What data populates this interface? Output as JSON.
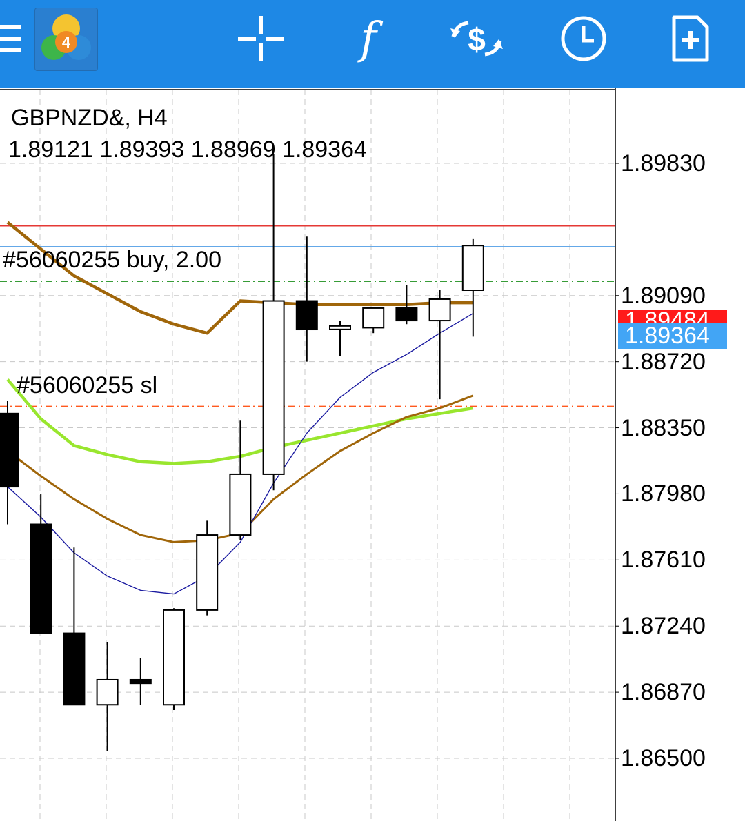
{
  "toolbar": {
    "background": "#1e88e5",
    "icons": [
      "menu-icon",
      "mt4-logo",
      "crosshair-icon",
      "indicators-icon",
      "trade-icon",
      "timeframe-clock-icon",
      "new-order-icon"
    ]
  },
  "chart": {
    "symbol_timeframe": "GBPNZD&, H4",
    "ohlc": "1.89121 1.89393 1.88969 1.89364",
    "order_label": "#56060255 buy, 2.00",
    "sl_label": "#56060255 sl",
    "current_price": "1.89364",
    "ask_price": "1.89484",
    "axis_ticks": [
      "1.89830",
      "1.89090",
      "1.88720",
      "1.88350",
      "1.87980",
      "1.87610",
      "1.87240",
      "1.86870",
      "1.86500"
    ]
  },
  "chart_data": {
    "type": "candlestick",
    "title": "GBPNZD&, H4",
    "ylim": [
      1.8638,
      1.9008
    ],
    "candles": [
      {
        "o": 1.8843,
        "h": 1.885,
        "l": 1.8781,
        "c": 1.8802
      },
      {
        "o": 1.8781,
        "h": 1.8798,
        "l": 1.8723,
        "c": 1.872
      },
      {
        "o": 1.872,
        "h": 1.8768,
        "l": 1.868,
        "c": 1.868
      },
      {
        "o": 1.868,
        "h": 1.8715,
        "l": 1.8654,
        "c": 1.8694
      },
      {
        "o": 1.8694,
        "h": 1.8706,
        "l": 1.868,
        "c": 1.8692
      },
      {
        "o": 1.868,
        "h": 1.8734,
        "l": 1.8677,
        "c": 1.8733
      },
      {
        "o": 1.8733,
        "h": 1.8783,
        "l": 1.873,
        "c": 1.8775
      },
      {
        "o": 1.8775,
        "h": 1.8839,
        "l": 1.8772,
        "c": 1.8809
      },
      {
        "o": 1.8809,
        "h": 1.8988,
        "l": 1.88,
        "c": 1.8906
      },
      {
        "o": 1.8906,
        "h": 1.8942,
        "l": 1.8872,
        "c": 1.889
      },
      {
        "o": 1.8892,
        "h": 1.8895,
        "l": 1.8875,
        "c": 1.8892
      },
      {
        "o": 1.8891,
        "h": 1.8898,
        "l": 1.8888,
        "c": 1.8902
      },
      {
        "o": 1.8902,
        "h": 1.8915,
        "l": 1.8893,
        "c": 1.8895
      },
      {
        "o": 1.8895,
        "h": 1.8912,
        "l": 1.8851,
        "c": 1.8907
      },
      {
        "o": 1.8912,
        "h": 1.8941,
        "l": 1.8886,
        "c": 1.8937
      }
    ],
    "moving_averages": [
      {
        "color": "#a0660a",
        "values": [
          1.895,
          1.8935,
          1.892,
          1.891,
          1.89,
          1.8893,
          1.8888,
          1.8906,
          1.8905,
          1.8904,
          1.8904,
          1.8904,
          1.8904,
          1.8905,
          1.8905
        ]
      },
      {
        "color": "#99e62e",
        "values": [
          1.8862,
          1.884,
          1.8825,
          1.882,
          1.8816,
          1.8815,
          1.8816,
          1.8819,
          1.8824,
          1.8828,
          1.8832,
          1.8836,
          1.884,
          1.8843,
          1.8846
        ]
      },
      {
        "color": "#a0660a",
        "values": [
          1.8822,
          1.8808,
          1.8795,
          1.8784,
          1.8775,
          1.8771,
          1.8772,
          1.8776,
          1.8795,
          1.8809,
          1.8822,
          1.8832,
          1.8841,
          1.8846,
          1.8853
        ]
      },
      {
        "color": "#1a1aa0",
        "values": [
          1.8802,
          1.8785,
          1.8765,
          1.8752,
          1.8744,
          1.8742,
          1.8752,
          1.8771,
          1.8804,
          1.8832,
          1.8852,
          1.8866,
          1.8876,
          1.8888,
          1.8899
        ]
      }
    ],
    "horizontal_lines": [
      {
        "name": "ask",
        "value": 1.8948,
        "color": "#e53935",
        "style": "solid"
      },
      {
        "name": "bid",
        "value": 1.89364,
        "color": "#64a8e8",
        "style": "solid"
      },
      {
        "name": "order",
        "value": 1.8917,
        "color": "#1b8f1b",
        "style": "dashdot"
      },
      {
        "name": "sl",
        "value": 1.8847,
        "color": "#ff5a1f",
        "style": "dashdot"
      }
    ],
    "grid": true
  }
}
